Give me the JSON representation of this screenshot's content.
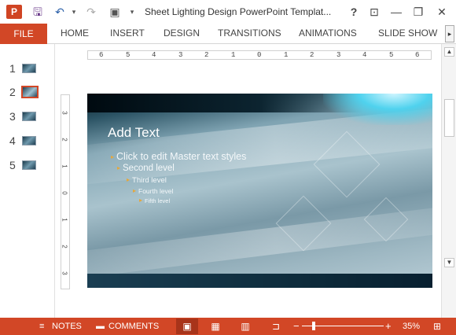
{
  "titlebar": {
    "app_badge": "P",
    "title": "Sheet Lighting Design PowerPoint Templat...",
    "icons": [
      "powerpoint-logo-icon",
      "save-icon",
      "undo-icon",
      "redo-icon",
      "start-presentation-icon",
      "customize-dropdown-icon",
      "help-icon",
      "ribbon-display-icon",
      "minimize-icon",
      "restore-icon",
      "close-icon"
    ],
    "help": "?",
    "minimize": "—",
    "restore": "❐",
    "close": "✕",
    "save": "🖫",
    "undo": "↶",
    "redo": "↷",
    "dropdown": "▾",
    "present": "▣",
    "ribbon_display": "⊡"
  },
  "ribbon": {
    "file_label": "FILE",
    "tabs": [
      {
        "label": "HOME"
      },
      {
        "label": "INSERT"
      },
      {
        "label": "DESIGN"
      },
      {
        "label": "TRANSITIONS"
      },
      {
        "label": "ANIMATIONS"
      },
      {
        "label": "SLIDE SHOW"
      }
    ],
    "scroll_glyph": "▸"
  },
  "thumbnails": {
    "items": [
      {
        "number": "1",
        "selected": false
      },
      {
        "number": "2",
        "selected": true
      },
      {
        "number": "3",
        "selected": false
      },
      {
        "number": "4",
        "selected": false
      },
      {
        "number": "5",
        "selected": false
      }
    ]
  },
  "rulers": {
    "horizontal": [
      "6",
      "5",
      "4",
      "3",
      "2",
      "1",
      "0",
      "1",
      "2",
      "3",
      "4",
      "5",
      "6"
    ],
    "vertical": [
      "3",
      "2",
      "1",
      "0",
      "1",
      "2",
      "3"
    ]
  },
  "slide": {
    "title": "Add Text",
    "levels": [
      "Click to edit Master text styles",
      "Second level",
      "Third level",
      "Fourth level",
      "Fifth level"
    ],
    "bullet": "▸",
    "colors": {
      "bullet": "#e6a73a",
      "accent_glow": "#4fd2ee",
      "dark_band": "#0c2430"
    }
  },
  "statusbar": {
    "notes_label": "NOTES",
    "comments_label": "COMMENTS",
    "zoom_minus": "−",
    "zoom_plus": "+",
    "zoom_value": "35%",
    "zoom_level_fraction": 0.35,
    "views": [
      "normal-view-icon",
      "slide-sorter-icon",
      "reading-view-icon",
      "slide-show-icon"
    ],
    "notes_glyph": "≡",
    "comments_glyph": "▬",
    "normal_glyph": "▣",
    "sorter_glyph": "▦",
    "reading_glyph": "▥",
    "show_glyph": "⊐",
    "fit_glyph": "⊞"
  },
  "colors": {
    "accent": "#d24726"
  }
}
